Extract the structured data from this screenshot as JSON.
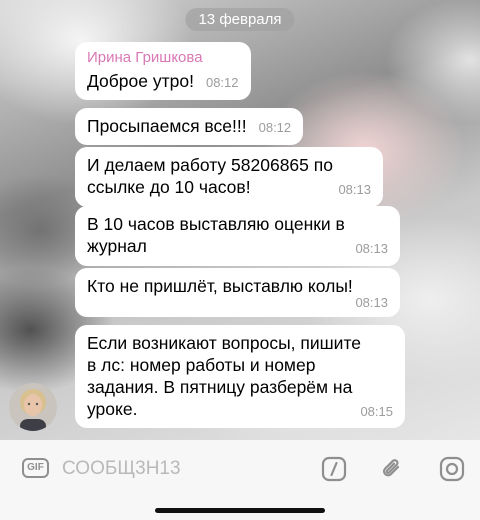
{
  "chat": {
    "date_label": "13 февраля",
    "messages": [
      {
        "sender": "Ирина Гришкова",
        "text": "Доброе утро!",
        "time": "08:12"
      },
      {
        "text": "Просыпаемся все!!!",
        "time": "08:12"
      },
      {
        "text_lines": [
          "И делаем работу 58206865 по",
          "ссылке до 10 часов!"
        ],
        "time": "08:13"
      },
      {
        "text_lines": [
          "В 10 часов выставляю оценки в",
          "журнал"
        ],
        "time": "08:13"
      },
      {
        "text": "Кто не пришлёт, выставлю колы!",
        "time": "08:13"
      },
      {
        "text_lines": [
          "Если возникают вопросы, пишите",
          "в лс: номер работы и номер",
          "задания. В пятницу разберём на",
          "уроке."
        ],
        "time": "08:15"
      }
    ]
  },
  "composer": {
    "gif_label": "GIF",
    "placeholder": "СООБЩ3Н13",
    "icons": [
      "gif-icon",
      "command-slash-icon",
      "paperclip-icon",
      "camera-icon"
    ]
  },
  "colors": {
    "sender_name": "#d978b4",
    "timestamp": "#9c9c9c",
    "bubble": "#ffffff",
    "input_bar": "#f7f7f7"
  }
}
